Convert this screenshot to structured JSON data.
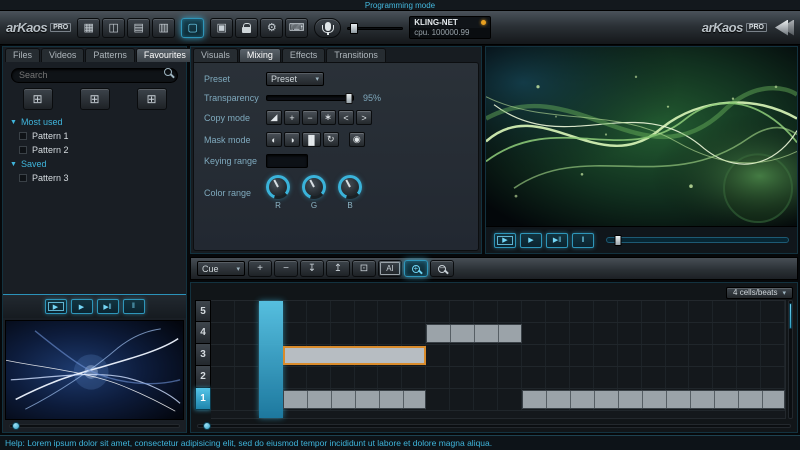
{
  "theme": {
    "accent": "#35aed6",
    "selection": "#d98b2b",
    "led": "#e8a020"
  },
  "icons": {
    "dropdown": "▾",
    "collapse": "▼"
  },
  "mode_label": "Programming mode",
  "brand": {
    "name": "arKaos",
    "tier": "PRO"
  },
  "toolbar": {
    "buttons_left": [
      {
        "name": "mixer-view-button",
        "glyph": "▦"
      },
      {
        "name": "preview-monitor-button",
        "glyph": "◫"
      },
      {
        "name": "banks-view-button",
        "glyph": "▤"
      },
      {
        "name": "piano-roll-button",
        "glyph": "▥"
      }
    ],
    "display_button": {
      "name": "display-output-button",
      "glyph": "▢",
      "active": true
    },
    "buttons_mid": [
      {
        "name": "trigger-pad-button",
        "glyph": "▣"
      },
      {
        "name": "lock-button",
        "icon": "lock-icon"
      },
      {
        "name": "settings-button",
        "glyph": "⚙"
      },
      {
        "name": "midi-keyboard-button",
        "glyph": "⌨"
      }
    ],
    "volume_percent": 12,
    "klingnet": {
      "label": "KLING-NET",
      "cpu": "cpu. 100000.99"
    }
  },
  "left_panel": {
    "tabs": [
      "Files",
      "Videos",
      "Patterns",
      "Favourites"
    ],
    "active_tab": "Favourites",
    "search_placeholder": "Search",
    "library_buttons": [
      {
        "name": "pattern-new-button",
        "glyph": "⊞"
      },
      {
        "name": "pattern-save-button",
        "glyph": "⊞"
      },
      {
        "name": "pattern-load-button",
        "glyph": "⊞"
      }
    ],
    "tree": [
      {
        "type": "group",
        "label": "Most used"
      },
      {
        "type": "item",
        "label": "Pattern 1"
      },
      {
        "type": "item",
        "label": "Pattern 2"
      },
      {
        "type": "group",
        "label": "Saved"
      },
      {
        "type": "item",
        "label": "Pattern 3"
      }
    ],
    "transport": [
      {
        "name": "cue-play-button",
        "glyph": "▶",
        "boxed": true
      },
      {
        "name": "play-button",
        "glyph": "▶"
      },
      {
        "name": "play-pause-button",
        "glyph": "▶‖"
      },
      {
        "name": "pause-button",
        "glyph": "‖"
      }
    ]
  },
  "mixer_panel": {
    "tabs": [
      "Visuals",
      "Mixing",
      "Effects",
      "Transitions"
    ],
    "active_tab": "Mixing",
    "rows": {
      "preset": {
        "label": "Preset",
        "value": "Preset"
      },
      "transparency": {
        "label": "Transparency",
        "value": "95%",
        "percent": 95
      },
      "copy_mode": {
        "label": "Copy mode",
        "buttons": [
          {
            "name": "copy-normal-button",
            "glyph": "◢"
          },
          {
            "name": "copy-add-button",
            "glyph": "+"
          },
          {
            "name": "copy-subtract-button",
            "glyph": "−"
          },
          {
            "name": "copy-multiply-button",
            "glyph": "∗"
          },
          {
            "name": "copy-prev-button",
            "glyph": "<"
          },
          {
            "name": "copy-next-button",
            "glyph": ">"
          }
        ]
      },
      "mask_mode": {
        "label": "Mask mode",
        "buttons": [
          {
            "name": "mask-half-button",
            "glyph": "◐"
          },
          {
            "name": "mask-invert-button",
            "glyph": "◑"
          },
          {
            "name": "mask-bars-button",
            "glyph": "▐▌"
          },
          {
            "name": "mask-rotate-button",
            "glyph": "↻"
          }
        ],
        "extra_button": {
          "name": "mask-target-button",
          "glyph": "◉"
        }
      },
      "keying": {
        "label": "Keying range",
        "value": ""
      },
      "color": {
        "label": "Color range",
        "knobs": [
          {
            "label": "R"
          },
          {
            "label": "G"
          },
          {
            "label": "B"
          }
        ]
      }
    }
  },
  "right_panel": {
    "transport": [
      {
        "name": "cue-play-button",
        "glyph": "▶",
        "boxed": true
      },
      {
        "name": "play-button",
        "glyph": "▶"
      },
      {
        "name": "play-pause-button",
        "glyph": "▶‖"
      },
      {
        "name": "pause-button",
        "glyph": "‖"
      }
    ],
    "position_percent": 6
  },
  "sequencer": {
    "toolbar": {
      "cue_label": "Cue",
      "buttons": [
        {
          "name": "add-cue-button",
          "glyph": "+"
        },
        {
          "name": "remove-cue-button",
          "glyph": "−"
        },
        {
          "name": "import-cue-button",
          "glyph": "↧"
        },
        {
          "name": "export-cue-button",
          "glyph": "↥"
        },
        {
          "name": "display-cue-button",
          "glyph": "⊡"
        },
        {
          "name": "text-overlay-button",
          "glyph": "AI",
          "boxed": true
        },
        {
          "name": "zoom-in-button",
          "icon": "mag-plus-icon",
          "active": true
        },
        {
          "name": "zoom-out-button",
          "icon": "mag-minus-icon"
        }
      ]
    },
    "cells_beats": "4 cells/beats",
    "rows": [
      "5",
      "4",
      "3",
      "2",
      "1"
    ],
    "active_row": "1",
    "columns": 24,
    "playhead_col": 2,
    "clips": [
      {
        "row": "3",
        "col": 3,
        "len": 6,
        "selected": true
      },
      {
        "row": "4",
        "col": 9,
        "len": 4,
        "selected": false
      },
      {
        "row": "1",
        "col": 3,
        "len": 6,
        "selected": false
      },
      {
        "row": "1",
        "col": 13,
        "len": 11,
        "selected": false
      }
    ]
  },
  "status": {
    "help": "Help: Lorem ipsum dolor sit amet, consectetur adipisicing elit, sed do eiusmod tempor incididunt ut labore et dolore magna aliqua."
  }
}
